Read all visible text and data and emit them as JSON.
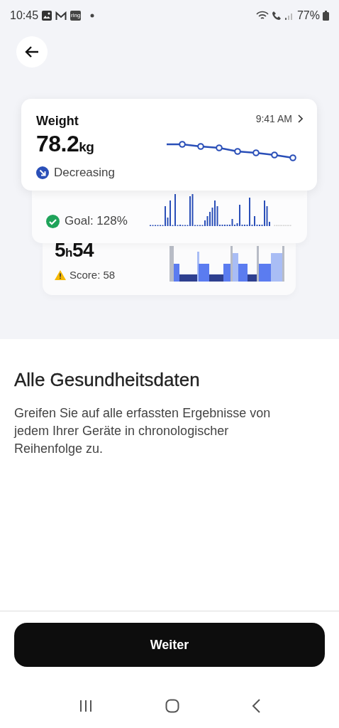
{
  "status_bar": {
    "time": "10:45",
    "notification_label": "ring",
    "battery": "77%"
  },
  "cards": [
    {
      "kind": "weight",
      "title": "Weight",
      "value": "78.2",
      "unit": "kg",
      "time": "9:41 AM",
      "trend": "Decreasing"
    },
    {
      "kind": "steps",
      "goal": "Goal: 128%"
    },
    {
      "kind": "sleep",
      "hours": "5",
      "hours_unit": "h",
      "minutes": "54",
      "score": "Score: 58"
    }
  ],
  "heading": "Alle Gesundheitsdaten",
  "description": "Greifen Sie auf alle erfassten Ergebnisse von jedem Ihrer Geräte in chronologischer Reihenfolge zu.",
  "button": "Weiter"
}
